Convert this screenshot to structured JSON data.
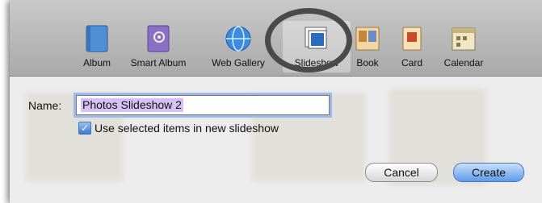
{
  "toolbar": {
    "items": [
      {
        "label": "Album",
        "icon": "album-icon"
      },
      {
        "label": "Smart Album",
        "icon": "smart-album-icon"
      },
      {
        "label": "Web Gallery",
        "icon": "web-gallery-icon"
      },
      {
        "label": "Slideshow",
        "icon": "slideshow-icon",
        "selected": true
      },
      {
        "label": "Book",
        "icon": "book-icon"
      },
      {
        "label": "Card",
        "icon": "card-icon"
      },
      {
        "label": "Calendar",
        "icon": "calendar-icon"
      }
    ]
  },
  "form": {
    "name_label": "Name:",
    "name_value": "Photos Slideshow 2",
    "checkbox_label": "Use selected items in new slideshow",
    "checkbox_checked": true
  },
  "buttons": {
    "cancel": "Cancel",
    "create": "Create"
  },
  "colors": {
    "accent": "#5d9bea",
    "selection": "#d5c2f5",
    "focus_ring": "#9cb9ea",
    "annotation": "#4a4a4a"
  }
}
